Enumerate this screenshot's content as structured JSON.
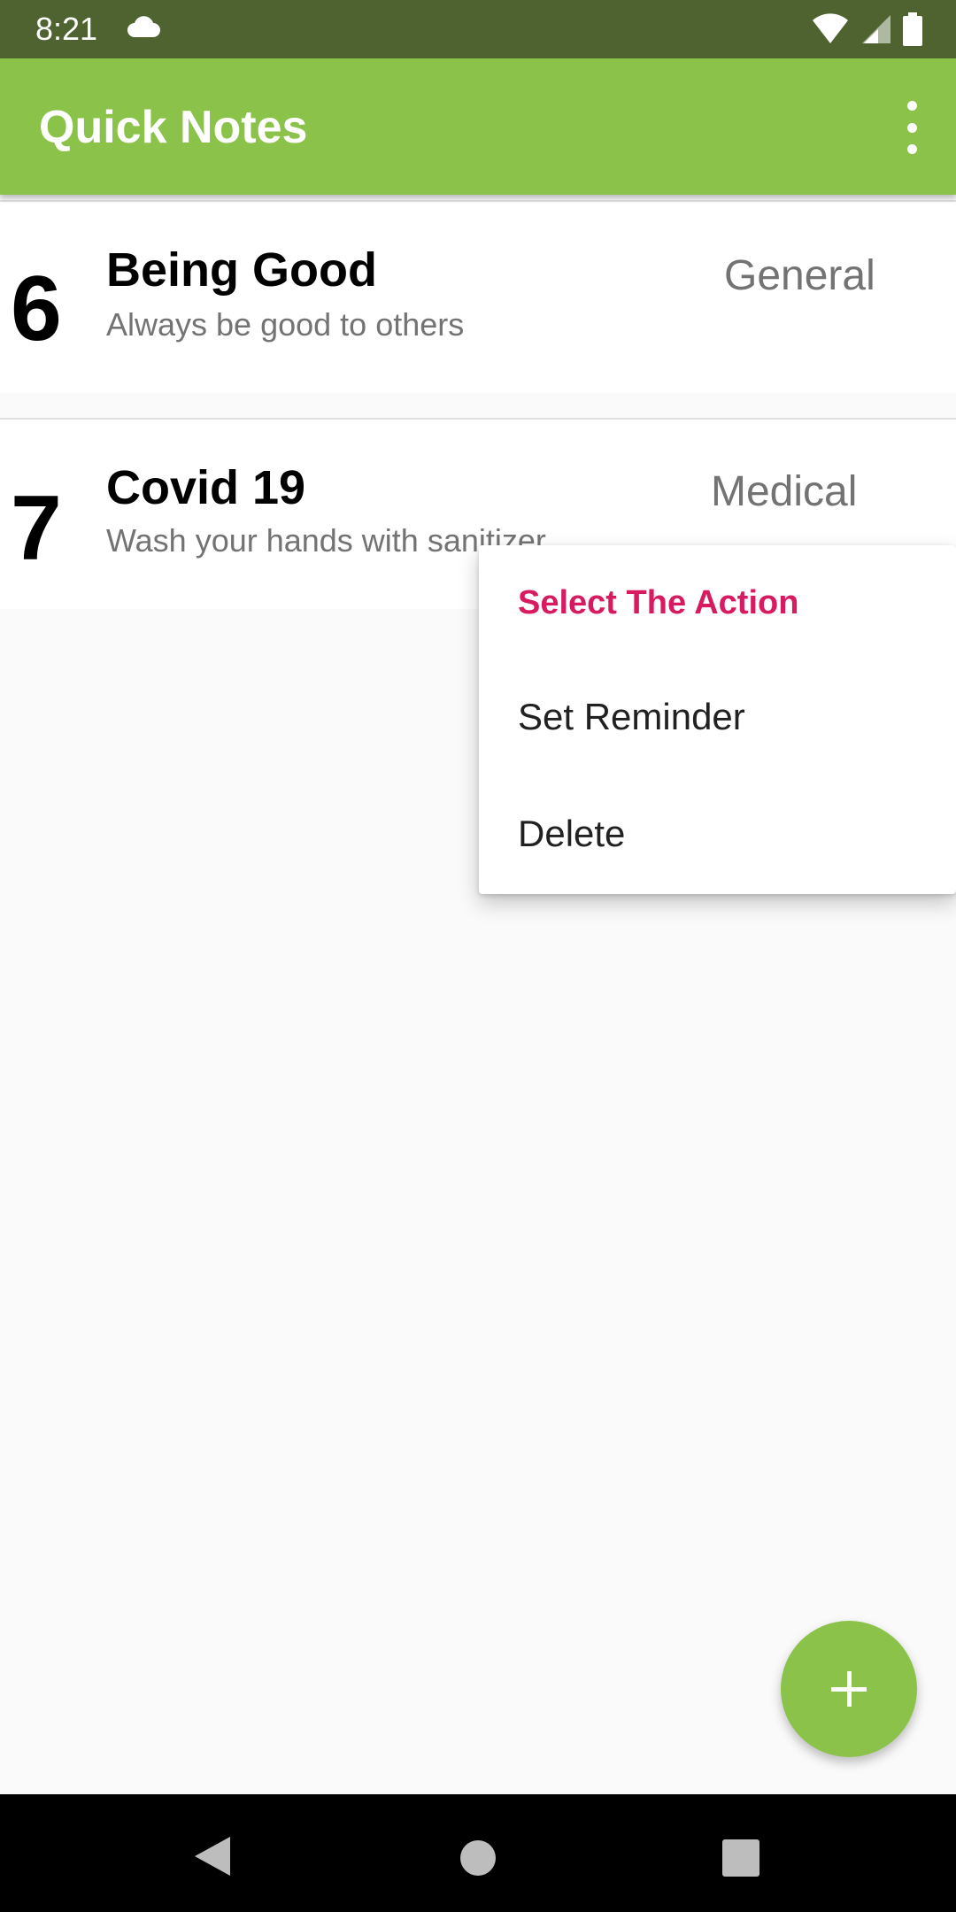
{
  "status_bar": {
    "time": "8:21"
  },
  "app_bar": {
    "title": "Quick Notes"
  },
  "notes": [
    {
      "number": "6",
      "title": "Being Good",
      "description": "Always be good to others",
      "category": "General"
    },
    {
      "number": "7",
      "title": "Covid 19",
      "description": "Wash your hands with sanitizer",
      "category": "Medical"
    }
  ],
  "context_menu": {
    "title": "Select The Action",
    "items": [
      "Set Reminder",
      "Delete"
    ]
  },
  "colors": {
    "status_bar": "#4e6330",
    "app_bar": "#8bc34a",
    "menu_title": "#d81b60",
    "fab": "#8bc34a"
  },
  "icons": [
    "cloud-icon",
    "wifi-icon",
    "signal-icon",
    "battery-icon",
    "more-vert-icon",
    "add-icon",
    "back-icon",
    "home-icon",
    "recents-icon"
  ]
}
